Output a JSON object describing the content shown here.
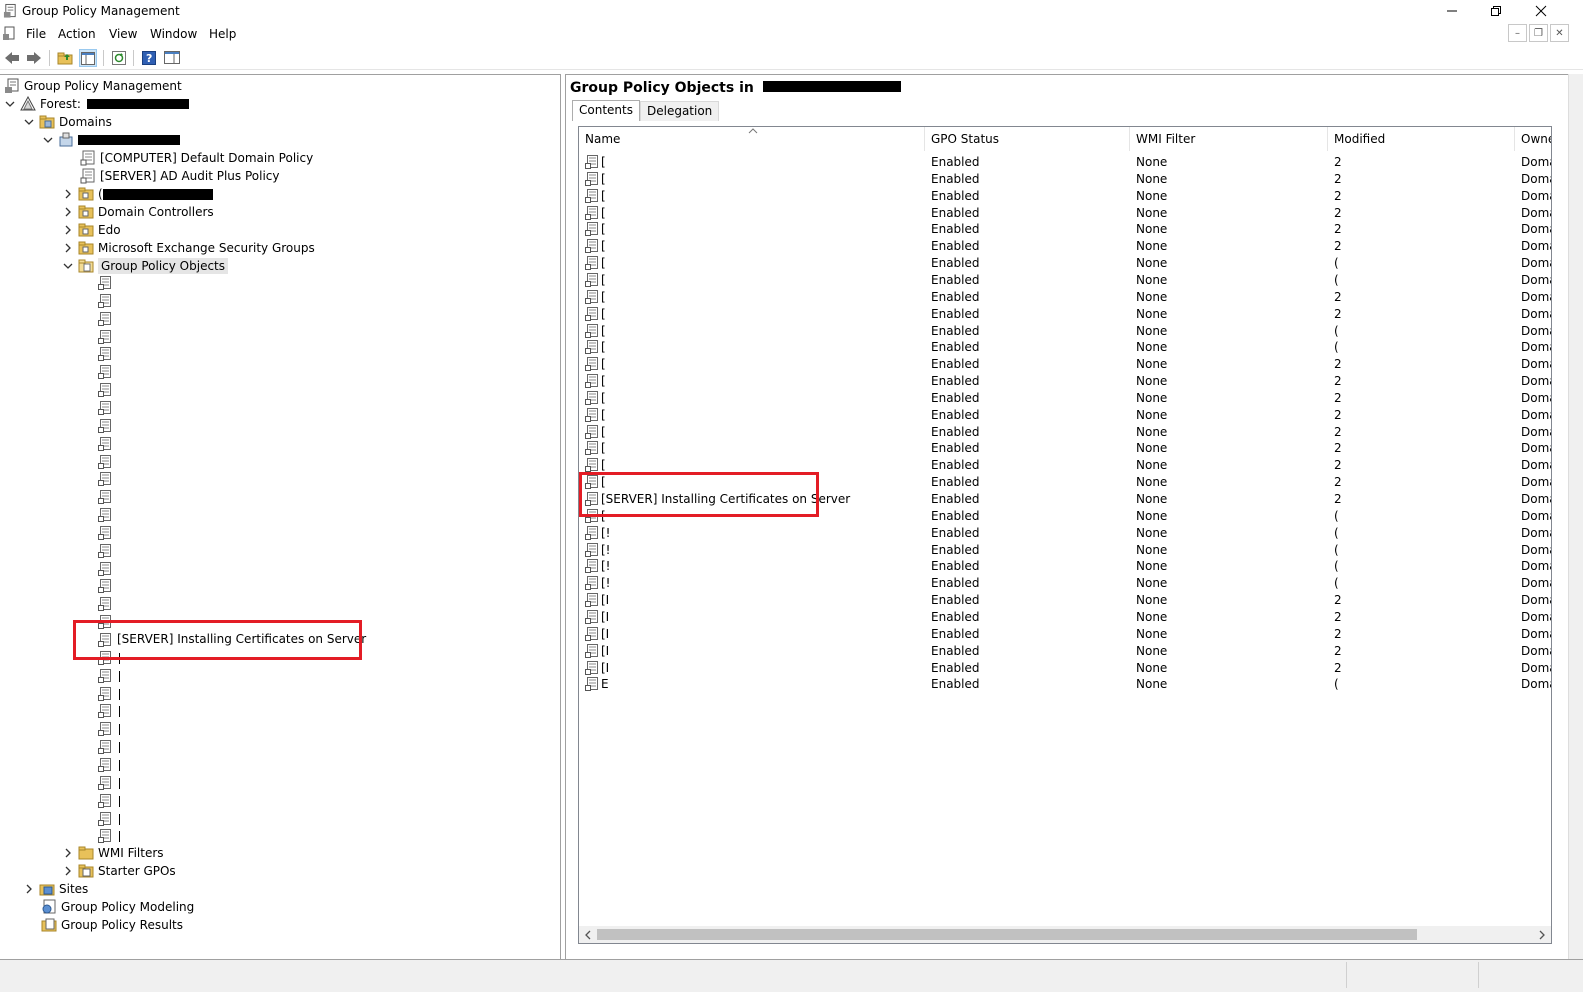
{
  "window": {
    "title": "Group Policy Management"
  },
  "menu": {
    "items": [
      "File",
      "Action",
      "View",
      "Window",
      "Help"
    ]
  },
  "toolbar": {
    "buttons": [
      "back-icon",
      "forward-icon",
      "up-folder-icon",
      "show-hide-console-tree-icon",
      "refresh-icon",
      "help-icon",
      "properties-icon"
    ]
  },
  "tree": {
    "root": "Group Policy Management",
    "forest_label": "Forest:",
    "domains": "Domains",
    "default_domain_policy": "[COMPUTER] Default Domain Policy",
    "ad_audit_policy": "[SERVER] AD Audit Plus Policy",
    "ou_redacted_prefix": "(",
    "domain_controllers": "Domain Controllers",
    "edo": "Edo",
    "exchange_groups": "Microsoft Exchange Security Groups",
    "gpo_folder": "Group Policy Objects",
    "highlighted_gpo": "[SERVER] Installing Certificates on Server",
    "wmi_filters": "WMI Filters",
    "starter_gpos": "Starter GPOs",
    "sites": "Sites",
    "modeling": "Group Policy Modeling",
    "results": "Group Policy Results"
  },
  "right": {
    "title": "Group Policy Objects in",
    "tabs": [
      "Contents",
      "Delegation"
    ],
    "columns": [
      "Name",
      "GPO Status",
      "WMI Filter",
      "Modified",
      "Owner"
    ],
    "rows": [
      {
        "name": "[",
        "status": "Enabled",
        "wmi": "None",
        "modified": "2",
        "owner": "Domai"
      },
      {
        "name": "[",
        "status": "Enabled",
        "wmi": "None",
        "modified": "2",
        "owner": "Domai"
      },
      {
        "name": "[",
        "status": "Enabled",
        "wmi": "None",
        "modified": "2",
        "owner": "Domai"
      },
      {
        "name": "[",
        "status": "Enabled",
        "wmi": "None",
        "modified": "2",
        "owner": "Domai"
      },
      {
        "name": "[",
        "status": "Enabled",
        "wmi": "None",
        "modified": "2",
        "owner": "Domai"
      },
      {
        "name": "[",
        "status": "Enabled",
        "wmi": "None",
        "modified": "2",
        "owner": "Domai"
      },
      {
        "name": "[",
        "status": "Enabled",
        "wmi": "None",
        "modified": "(",
        "owner": "Domai"
      },
      {
        "name": "[",
        "status": "Enabled",
        "wmi": "None",
        "modified": "(",
        "owner": "Domai"
      },
      {
        "name": "[",
        "status": "Enabled",
        "wmi": "None",
        "modified": "2",
        "owner": "Domai"
      },
      {
        "name": "[",
        "status": "Enabled",
        "wmi": "None",
        "modified": "2",
        "owner": "Domai"
      },
      {
        "name": "[",
        "status": "Enabled",
        "wmi": "None",
        "modified": "(",
        "owner": "Domai"
      },
      {
        "name": "[",
        "status": "Enabled",
        "wmi": "None",
        "modified": "(",
        "owner": "Domai"
      },
      {
        "name": "[",
        "status": "Enabled",
        "wmi": "None",
        "modified": "2",
        "owner": "Domai"
      },
      {
        "name": "[",
        "status": "Enabled",
        "wmi": "None",
        "modified": "2",
        "owner": "Domai"
      },
      {
        "name": "[",
        "status": "Enabled",
        "wmi": "None",
        "modified": "2",
        "owner": "Domai"
      },
      {
        "name": "[",
        "status": "Enabled",
        "wmi": "None",
        "modified": "2",
        "owner": "Domai"
      },
      {
        "name": "[",
        "status": "Enabled",
        "wmi": "None",
        "modified": "2",
        "owner": "Domai"
      },
      {
        "name": "[",
        "status": "Enabled",
        "wmi": "None",
        "modified": "2",
        "owner": "Domai"
      },
      {
        "name": "[",
        "status": "Enabled",
        "wmi": "None",
        "modified": "2",
        "owner": "Domai"
      },
      {
        "name": "[",
        "status": "Enabled",
        "wmi": "None",
        "modified": "2",
        "owner": "Domai"
      },
      {
        "name": "[SERVER] Installing Certificates on Server",
        "status": "Enabled",
        "wmi": "None",
        "modified": "2",
        "owner": "Domai"
      },
      {
        "name": "[",
        "status": "Enabled",
        "wmi": "None",
        "modified": "(",
        "owner": "Domai"
      },
      {
        "name": "[!",
        "status": "Enabled",
        "wmi": "None",
        "modified": "(",
        "owner": "Domai"
      },
      {
        "name": "[!",
        "status": "Enabled",
        "wmi": "None",
        "modified": "(",
        "owner": "Domai"
      },
      {
        "name": "[!",
        "status": "Enabled",
        "wmi": "None",
        "modified": "(",
        "owner": "Domai"
      },
      {
        "name": "[!",
        "status": "Enabled",
        "wmi": "None",
        "modified": "(",
        "owner": "Domai"
      },
      {
        "name": "[I",
        "status": "Enabled",
        "wmi": "None",
        "modified": "2",
        "owner": "Domai"
      },
      {
        "name": "[I",
        "status": "Enabled",
        "wmi": "None",
        "modified": "2",
        "owner": "Domai"
      },
      {
        "name": "[I",
        "status": "Enabled",
        "wmi": "None",
        "modified": "2",
        "owner": "Domai"
      },
      {
        "name": "[I",
        "status": "Enabled",
        "wmi": "None",
        "modified": "2",
        "owner": "Domai"
      },
      {
        "name": "[I",
        "status": "Enabled",
        "wmi": "None",
        "modified": "2",
        "owner": "Domai"
      },
      {
        "name": "E",
        "status": "Enabled",
        "wmi": "None",
        "modified": "(",
        "owner": "Domai"
      }
    ]
  },
  "colors": {
    "highlight": "#e31c25",
    "folder": "#e8c15a",
    "selected": "#e5e5e5"
  }
}
